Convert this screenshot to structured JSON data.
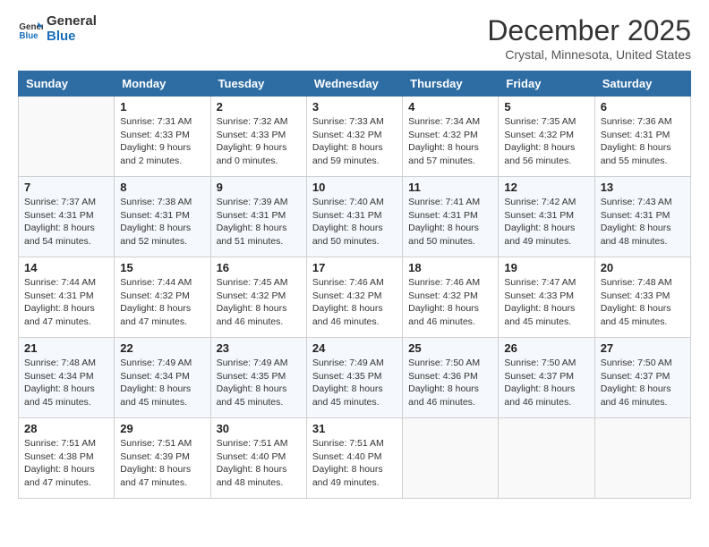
{
  "logo": {
    "general": "General",
    "blue": "Blue"
  },
  "title": "December 2025",
  "location": "Crystal, Minnesota, United States",
  "days_header": [
    "Sunday",
    "Monday",
    "Tuesday",
    "Wednesday",
    "Thursday",
    "Friday",
    "Saturday"
  ],
  "weeks": [
    [
      {
        "day": "",
        "info": ""
      },
      {
        "day": "1",
        "info": "Sunrise: 7:31 AM\nSunset: 4:33 PM\nDaylight: 9 hours\nand 2 minutes."
      },
      {
        "day": "2",
        "info": "Sunrise: 7:32 AM\nSunset: 4:33 PM\nDaylight: 9 hours\nand 0 minutes."
      },
      {
        "day": "3",
        "info": "Sunrise: 7:33 AM\nSunset: 4:32 PM\nDaylight: 8 hours\nand 59 minutes."
      },
      {
        "day": "4",
        "info": "Sunrise: 7:34 AM\nSunset: 4:32 PM\nDaylight: 8 hours\nand 57 minutes."
      },
      {
        "day": "5",
        "info": "Sunrise: 7:35 AM\nSunset: 4:32 PM\nDaylight: 8 hours\nand 56 minutes."
      },
      {
        "day": "6",
        "info": "Sunrise: 7:36 AM\nSunset: 4:31 PM\nDaylight: 8 hours\nand 55 minutes."
      }
    ],
    [
      {
        "day": "7",
        "info": "Sunrise: 7:37 AM\nSunset: 4:31 PM\nDaylight: 8 hours\nand 54 minutes."
      },
      {
        "day": "8",
        "info": "Sunrise: 7:38 AM\nSunset: 4:31 PM\nDaylight: 8 hours\nand 52 minutes."
      },
      {
        "day": "9",
        "info": "Sunrise: 7:39 AM\nSunset: 4:31 PM\nDaylight: 8 hours\nand 51 minutes."
      },
      {
        "day": "10",
        "info": "Sunrise: 7:40 AM\nSunset: 4:31 PM\nDaylight: 8 hours\nand 50 minutes."
      },
      {
        "day": "11",
        "info": "Sunrise: 7:41 AM\nSunset: 4:31 PM\nDaylight: 8 hours\nand 50 minutes."
      },
      {
        "day": "12",
        "info": "Sunrise: 7:42 AM\nSunset: 4:31 PM\nDaylight: 8 hours\nand 49 minutes."
      },
      {
        "day": "13",
        "info": "Sunrise: 7:43 AM\nSunset: 4:31 PM\nDaylight: 8 hours\nand 48 minutes."
      }
    ],
    [
      {
        "day": "14",
        "info": "Sunrise: 7:44 AM\nSunset: 4:31 PM\nDaylight: 8 hours\nand 47 minutes."
      },
      {
        "day": "15",
        "info": "Sunrise: 7:44 AM\nSunset: 4:32 PM\nDaylight: 8 hours\nand 47 minutes."
      },
      {
        "day": "16",
        "info": "Sunrise: 7:45 AM\nSunset: 4:32 PM\nDaylight: 8 hours\nand 46 minutes."
      },
      {
        "day": "17",
        "info": "Sunrise: 7:46 AM\nSunset: 4:32 PM\nDaylight: 8 hours\nand 46 minutes."
      },
      {
        "day": "18",
        "info": "Sunrise: 7:46 AM\nSunset: 4:32 PM\nDaylight: 8 hours\nand 46 minutes."
      },
      {
        "day": "19",
        "info": "Sunrise: 7:47 AM\nSunset: 4:33 PM\nDaylight: 8 hours\nand 45 minutes."
      },
      {
        "day": "20",
        "info": "Sunrise: 7:48 AM\nSunset: 4:33 PM\nDaylight: 8 hours\nand 45 minutes."
      }
    ],
    [
      {
        "day": "21",
        "info": "Sunrise: 7:48 AM\nSunset: 4:34 PM\nDaylight: 8 hours\nand 45 minutes."
      },
      {
        "day": "22",
        "info": "Sunrise: 7:49 AM\nSunset: 4:34 PM\nDaylight: 8 hours\nand 45 minutes."
      },
      {
        "day": "23",
        "info": "Sunrise: 7:49 AM\nSunset: 4:35 PM\nDaylight: 8 hours\nand 45 minutes."
      },
      {
        "day": "24",
        "info": "Sunrise: 7:49 AM\nSunset: 4:35 PM\nDaylight: 8 hours\nand 45 minutes."
      },
      {
        "day": "25",
        "info": "Sunrise: 7:50 AM\nSunset: 4:36 PM\nDaylight: 8 hours\nand 46 minutes."
      },
      {
        "day": "26",
        "info": "Sunrise: 7:50 AM\nSunset: 4:37 PM\nDaylight: 8 hours\nand 46 minutes."
      },
      {
        "day": "27",
        "info": "Sunrise: 7:50 AM\nSunset: 4:37 PM\nDaylight: 8 hours\nand 46 minutes."
      }
    ],
    [
      {
        "day": "28",
        "info": "Sunrise: 7:51 AM\nSunset: 4:38 PM\nDaylight: 8 hours\nand 47 minutes."
      },
      {
        "day": "29",
        "info": "Sunrise: 7:51 AM\nSunset: 4:39 PM\nDaylight: 8 hours\nand 47 minutes."
      },
      {
        "day": "30",
        "info": "Sunrise: 7:51 AM\nSunset: 4:40 PM\nDaylight: 8 hours\nand 48 minutes."
      },
      {
        "day": "31",
        "info": "Sunrise: 7:51 AM\nSunset: 4:40 PM\nDaylight: 8 hours\nand 49 minutes."
      },
      {
        "day": "",
        "info": ""
      },
      {
        "day": "",
        "info": ""
      },
      {
        "day": "",
        "info": ""
      }
    ]
  ]
}
